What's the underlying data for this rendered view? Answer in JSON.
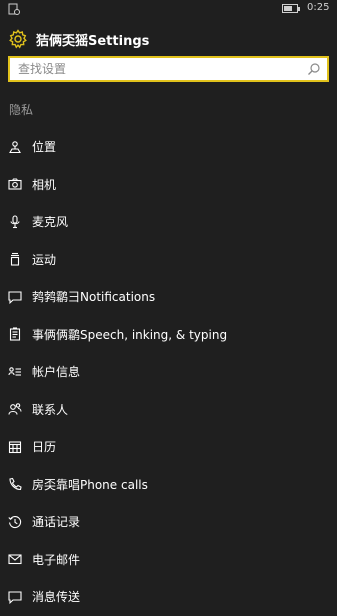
{
  "status_bar": {
    "time": "0:25",
    "battery_level": 0.7
  },
  "header": {
    "title": "狤俩奀猺Settings",
    "icon": "gear-icon"
  },
  "search": {
    "placeholder": "查找设置",
    "icon": "search-icon"
  },
  "section": {
    "title": "隐私"
  },
  "items": [
    {
      "label": "位置",
      "icon": "location-icon"
    },
    {
      "label": "相机",
      "icon": "camera-icon"
    },
    {
      "label": "麦克风",
      "icon": "microphone-icon"
    },
    {
      "label": "运动",
      "icon": "motion-icon"
    },
    {
      "label": "鹁鹁鹴彐Notifications",
      "icon": "notifications-icon"
    },
    {
      "label": "事俩俩鹴Speech, inking, & typing",
      "icon": "speech-icon"
    },
    {
      "label": "帐户信息",
      "icon": "account-info-icon"
    },
    {
      "label": "联系人",
      "icon": "contacts-icon"
    },
    {
      "label": "日历",
      "icon": "calendar-icon"
    },
    {
      "label": "房奀靠唱Phone calls",
      "icon": "phone-icon"
    },
    {
      "label": "通话记录",
      "icon": "call-history-icon"
    },
    {
      "label": "电子邮件",
      "icon": "email-icon"
    },
    {
      "label": "消息传送",
      "icon": "messaging-icon"
    }
  ],
  "colors": {
    "accent": "#e1c21c",
    "background": "#1f1f1f",
    "text": "#ffffff",
    "subtle": "#9a9a9a"
  }
}
